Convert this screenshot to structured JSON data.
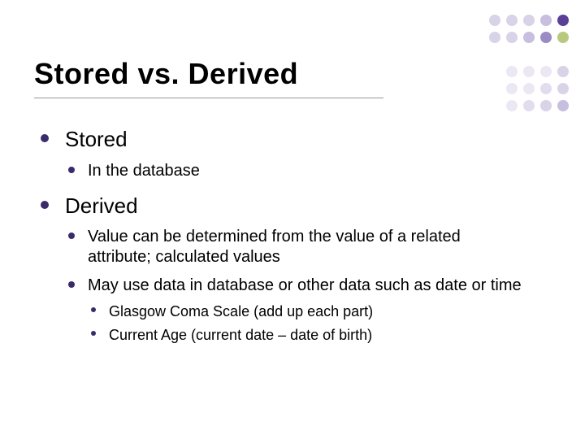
{
  "title": "Stored vs. Derived",
  "bullets": [
    {
      "text": "Stored",
      "children": [
        {
          "text": "In the database"
        }
      ]
    },
    {
      "text": "Derived",
      "children": [
        {
          "text": "Value can be determined from the value of a related attribute; calculated values"
        },
        {
          "text": "May use data in database or other data such as date or time",
          "children": [
            {
              "text": "Glasgow Coma Scale (add up each part)"
            },
            {
              "text": "Current Age (current date – date of birth)"
            }
          ]
        }
      ]
    }
  ]
}
